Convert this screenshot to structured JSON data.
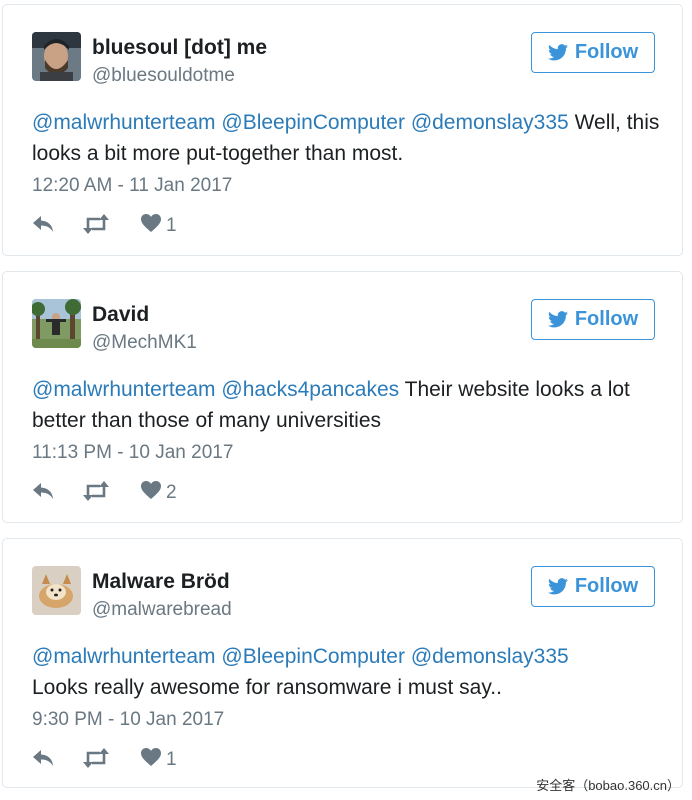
{
  "follow_label": "Follow",
  "tweets": [
    {
      "name": "bluesoul [dot] me",
      "handle": "@bluesouldotme",
      "mentions": [
        "@malwrhunterteam",
        "@BleepinComputer",
        "@demonslay335"
      ],
      "text": "Well, this looks a bit more put-together than most.",
      "timestamp": "12:20 AM - 11 Jan 2017",
      "likes": "1"
    },
    {
      "name": "David",
      "handle": "@MechMK1",
      "mentions": [
        "@malwrhunterteam",
        "@hacks4pancakes"
      ],
      "text": "Their website looks a lot better than those of many universities",
      "timestamp": "11:13 PM - 10 Jan 2017",
      "likes": "2"
    },
    {
      "name": "Malware Bröd",
      "handle": "@malwarebread",
      "mentions": [
        "@malwrhunterteam",
        "@BleepinComputer",
        "@demonslay335"
      ],
      "text": "Looks really awesome for ransomware i must say..",
      "timestamp": "9:30 PM - 10 Jan 2017",
      "likes": "1"
    }
  ],
  "watermark": "安全客（bobao.360.cn）",
  "colors": {
    "accent": "#3b94d9",
    "mention": "#2b7bb9",
    "meta": "#697882",
    "border": "#e1e8ed"
  }
}
